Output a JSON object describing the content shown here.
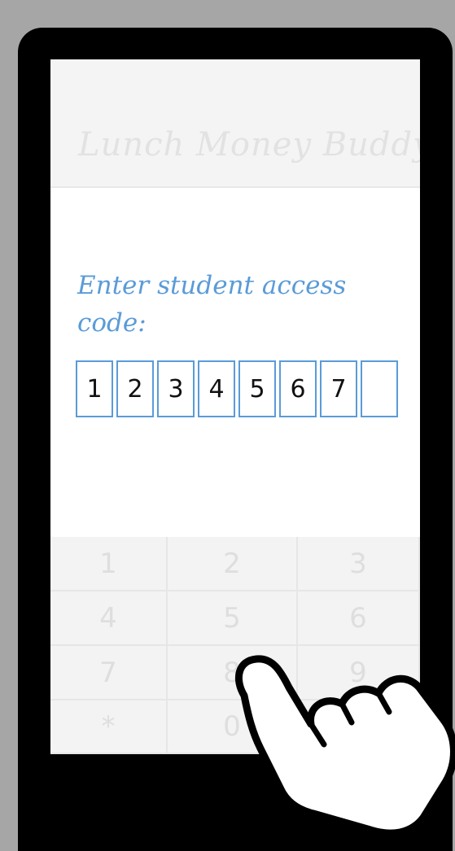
{
  "header": {
    "title": "Lunch Money Buddy"
  },
  "prompt": {
    "text": "Enter student access code:"
  },
  "code": {
    "digits": [
      "1",
      "2",
      "3",
      "4",
      "5",
      "6",
      "7",
      ""
    ]
  },
  "keypad": {
    "keys": [
      "1",
      "2",
      "3",
      "4",
      "5",
      "6",
      "7",
      "8",
      "9",
      "*",
      "0",
      ""
    ]
  },
  "colors": {
    "accent": "#5a9bd8",
    "frame": "#000000",
    "backdrop": "#a6a6a6"
  },
  "icons": {
    "pointer": "hand-pointer-icon"
  }
}
